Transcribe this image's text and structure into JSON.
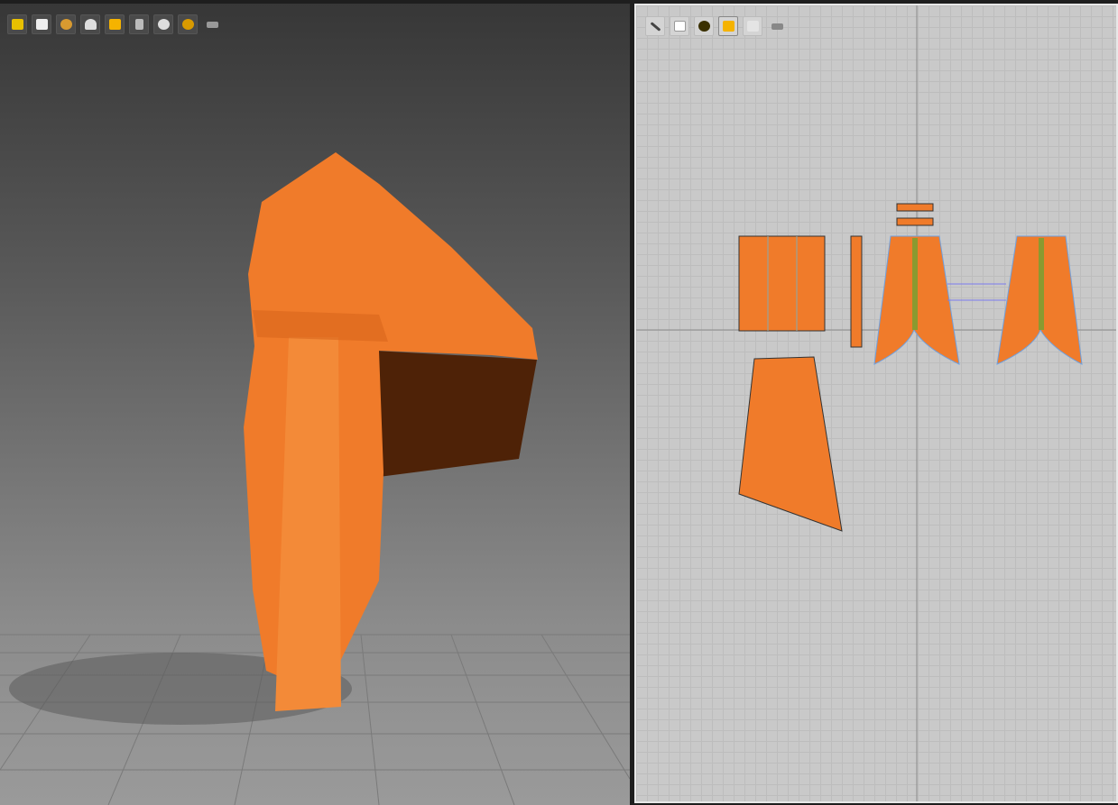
{
  "viewport_3d": {
    "toolbar": [
      "avatar-display-icon",
      "garment-display-icon",
      "texture-display-icon",
      "avatar-pose-icon",
      "fabric-render-icon",
      "pin-icon",
      "avatar-visibility-icon",
      "globe-render-icon",
      "export-icon"
    ]
  },
  "viewport_2d": {
    "toolbar": [
      "pen-visibility-icon",
      "garment-visibility-icon",
      "info-icon",
      "fabric-display-icon",
      "lock-garment-icon",
      "export-icon"
    ]
  },
  "colors": {
    "fabric": "#f07b2a",
    "fabric_shadow": "#5a2508",
    "accent": "#e8a000",
    "grid_line": "#bdbdbd"
  }
}
